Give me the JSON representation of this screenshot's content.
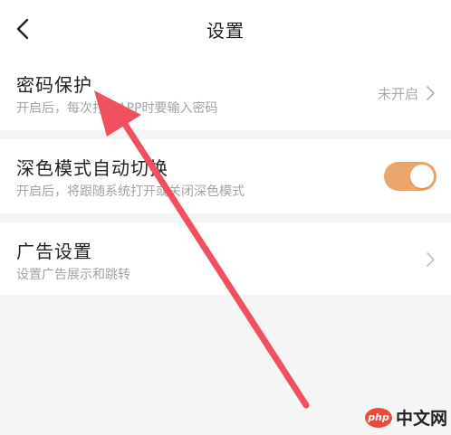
{
  "header": {
    "title": "设置",
    "back_icon": "chevron-left-icon"
  },
  "settings": {
    "password": {
      "title": "密码保护",
      "desc": "开启后，每次打开APP时要输入密码",
      "status": "未开启"
    },
    "dark_mode": {
      "title": "深色模式自动切换",
      "desc": "开启后，将跟随系统打开或关闭深色模式",
      "enabled": true
    },
    "ads": {
      "title": "广告设置",
      "desc": "设置广告展示和跳转"
    }
  },
  "watermark": {
    "badge": "php",
    "text": "中文网"
  },
  "colors": {
    "toggle_on": "#eba56a",
    "annotation_arrow": "#f0505f",
    "logo_red": "#ea4b3c"
  }
}
